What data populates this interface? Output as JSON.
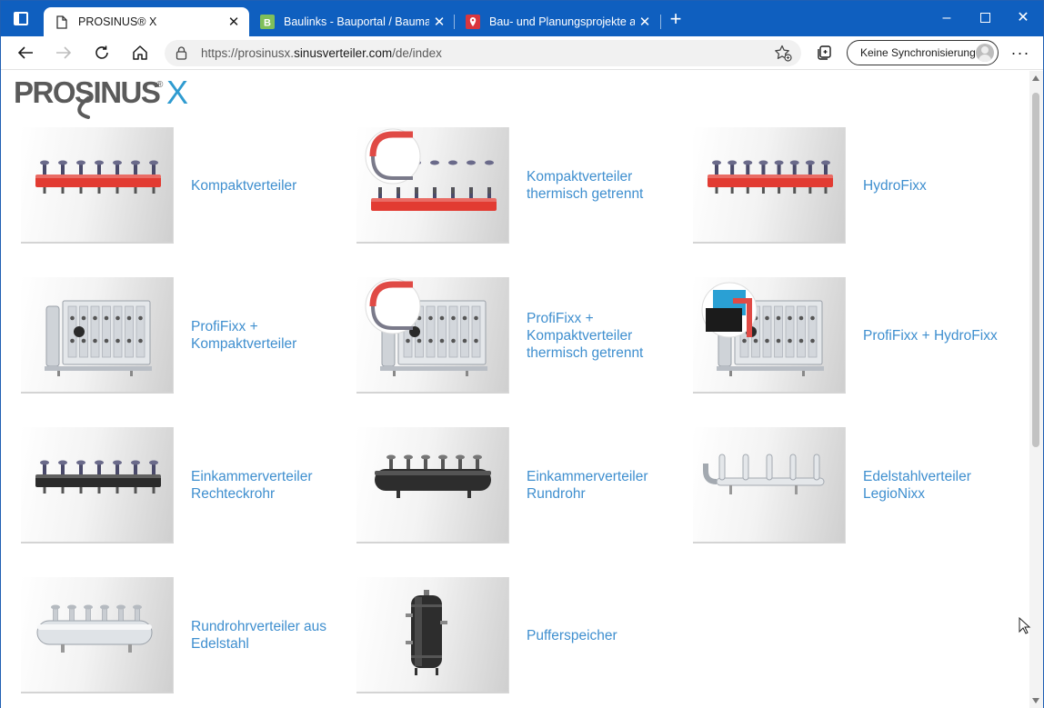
{
  "browser": {
    "tabs": [
      {
        "title": "PROSINUS® X",
        "active": true,
        "icon": "page-icon"
      },
      {
        "title": "Baulinks - Bauportal / Baumagaz",
        "active": false,
        "icon": "baulinks-favicon"
      },
      {
        "title": "Bau- und Planungsprojekte auf B",
        "active": false,
        "icon": "map-pin-favicon"
      }
    ],
    "url_prefix": "https://prosinusx.",
    "url_domain": "sinusverteiler.com",
    "url_path": "/de/index",
    "sync_label": "Keine Synchronisierung",
    "accent": "#0f5fbf"
  },
  "site": {
    "logo_text": "PROSINUS",
    "logo_x": "X",
    "logo_reg": "®",
    "link_color": "#3f8fcf",
    "products": [
      {
        "label": "Kompaktverteiler",
        "image": "red-compact-manifold"
      },
      {
        "label": "Kompaktverteiler\nthermisch getrennt",
        "image": "red-manifold-insulated"
      },
      {
        "label": "HydroFixx",
        "image": "red-hydrofixx-manifold"
      },
      {
        "label": "ProfiFixx +\nKompaktverteiler",
        "image": "steel-profifixx"
      },
      {
        "label": "ProfiFixx +\nKompaktverteiler\nthermisch getrennt",
        "image": "steel-profifixx-insulated"
      },
      {
        "label": "ProfiFixx + HydroFixx",
        "image": "steel-profifixx-hydrofixx"
      },
      {
        "label": "Einkammerverteiler\nRechteckrohr",
        "image": "black-rect-manifold"
      },
      {
        "label": "Einkammerverteiler\nRundrohr",
        "image": "black-round-manifold"
      },
      {
        "label": "Edelstahlverteiler\nLegioNixx",
        "image": "stainless-legionixx"
      },
      {
        "label": "Rundrohrverteiler aus\nEdelstahl",
        "image": "stainless-round-manifold"
      },
      {
        "label": "Pufferspeicher",
        "image": "buffer-tank"
      }
    ]
  }
}
